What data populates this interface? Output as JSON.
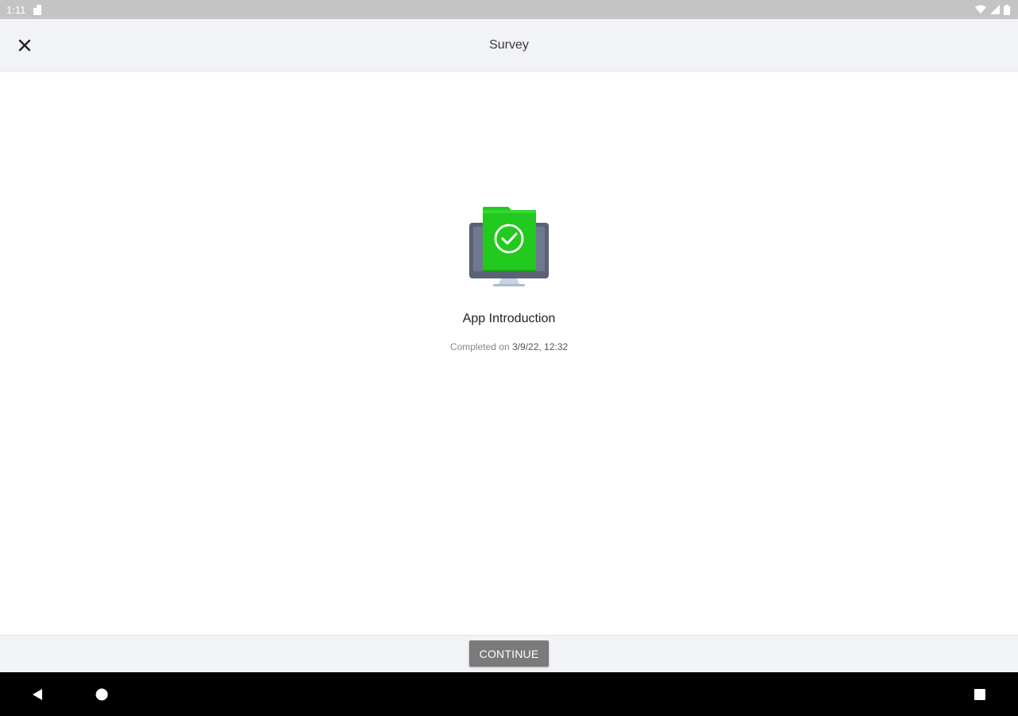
{
  "status_bar": {
    "time": "1:11",
    "icons": [
      "sd-card-icon",
      "wifi-icon",
      "signal-icon",
      "battery-icon"
    ]
  },
  "app_bar": {
    "title": "Survey",
    "close_icon": "close-icon"
  },
  "main": {
    "illustration_icon": "monitor-folder-check-icon",
    "survey_name": "App Introduction",
    "completed_label": "Completed on",
    "completed_date": "3/9/22, 12:32"
  },
  "footer": {
    "continue_label": "CONTINUE"
  },
  "nav_bar": {
    "icons": [
      "back-icon",
      "home-icon",
      "recents-icon"
    ]
  },
  "colors": {
    "accent_green": "#22c91e",
    "monitor_body": "#5a6275",
    "button_gray": "#7a7a7a",
    "app_bar_bg": "#f2f3f7"
  }
}
